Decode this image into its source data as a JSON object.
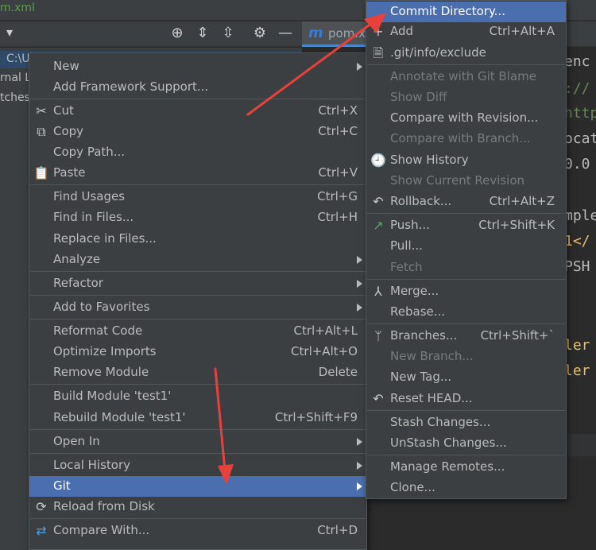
{
  "ide": {
    "file_title": "m.xml",
    "project_rows": [
      "C:\\U",
      "rnal L",
      "tches"
    ],
    "editor_tab": {
      "icon": "m",
      "label": "pom.x"
    },
    "editor_lines": [
      "enc",
      "://",
      "http",
      "ocat",
      "0.0",
      "mple",
      "1</",
      "PSH",
      "ler",
      "ler"
    ],
    "colors": {
      "bg": "#2b2b2b",
      "panel": "#3c3f41",
      "highlight": "#4b6eaf",
      "annotation": "#e8413b"
    }
  },
  "main_menu": {
    "new": "New",
    "add_framework": "Add Framework Support...",
    "cut": "Cut",
    "cut_sc": "Ctrl+X",
    "copy": "Copy",
    "copy_sc": "Ctrl+C",
    "copy_path": "Copy Path...",
    "paste": "Paste",
    "paste_sc": "Ctrl+V",
    "find_usages": "Find Usages",
    "find_usages_sc": "Ctrl+G",
    "find_in_files": "Find in Files...",
    "find_in_files_sc": "Ctrl+H",
    "replace_in_files": "Replace in Files...",
    "analyze": "Analyze",
    "refactor": "Refactor",
    "add_to_favorites": "Add to Favorites",
    "reformat_code": "Reformat Code",
    "reformat_code_sc": "Ctrl+Alt+L",
    "optimize_imports": "Optimize Imports",
    "optimize_imports_sc": "Ctrl+Alt+O",
    "remove_module": "Remove Module",
    "remove_module_sc": "Delete",
    "build_module": "Build Module 'test1'",
    "rebuild_module": "Rebuild Module 'test1'",
    "rebuild_module_sc": "Ctrl+Shift+F9",
    "open_in": "Open In",
    "local_history": "Local History",
    "git": "Git",
    "reload": "Reload from Disk",
    "compare_with": "Compare With...",
    "compare_with_sc": "Ctrl+D"
  },
  "git_menu": {
    "commit_directory": "Commit Directory...",
    "add": "Add",
    "add_sc": "Ctrl+Alt+A",
    "exclude": ".git/info/exclude",
    "annotate": "Annotate with Git Blame",
    "show_diff": "Show Diff",
    "compare_revision": "Compare with Revision...",
    "compare_branch": "Compare with Branch...",
    "show_history": "Show History",
    "show_current_revision": "Show Current Revision",
    "rollback": "Rollback...",
    "rollback_sc": "Ctrl+Alt+Z",
    "push": "Push...",
    "push_sc": "Ctrl+Shift+K",
    "pull": "Pull...",
    "fetch": "Fetch",
    "merge": "Merge...",
    "rebase": "Rebase...",
    "branches": "Branches...",
    "branches_sc": "Ctrl+Shift+`",
    "new_branch": "New Branch...",
    "new_tag": "New Tag...",
    "reset_head": "Reset HEAD...",
    "stash": "Stash Changes...",
    "unstash": "UnStash Changes...",
    "manage_remotes": "Manage Remotes...",
    "clone": "Clone..."
  }
}
